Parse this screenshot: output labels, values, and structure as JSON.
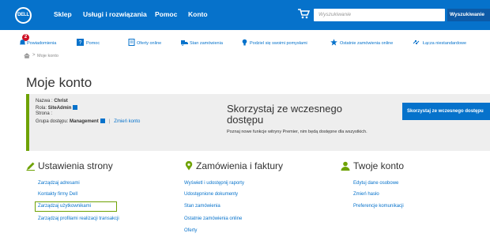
{
  "header": {
    "logo": "DELL",
    "nav": [
      "Sklep",
      "Usługi i rozwiązania",
      "Pomoc",
      "Konto"
    ],
    "search_placeholder": "Wyszukiwanie",
    "search_button": "Wyszukiwanie"
  },
  "subnav": {
    "badge": "2",
    "items": [
      "Powiadomienia",
      "Pomoc",
      "Oferty online",
      "Stan zamówienia",
      "Podziel się swoimi pomysłami",
      "Ostatnie zamówienia online",
      "Łącza niestandardowe"
    ]
  },
  "breadcrumb": {
    "current": "Moje konto"
  },
  "page_title": "Moje konto",
  "account": {
    "name_label": "Nazwa :",
    "name_value": "Christ",
    "role_label": "Rola:",
    "role_value": "SiteAdmin",
    "page_label": "Strona :",
    "group_label": "Grupa dostępu:",
    "group_value": "Management",
    "change_account": "Zmień konto"
  },
  "promo": {
    "title": "Skorzystaj ze wczesnego dostępu",
    "description": "Poznaj nowe funkcje witryny Premier, nim będą dostępne dla wszystkich.",
    "button": "Skorzystaj ze wczesnego dostępu"
  },
  "sections": {
    "settings": {
      "title": "Ustawienia strony",
      "links": [
        "Zarządzaj adresami",
        "Kontakty firmy Dell",
        "Zarządzaj użytkownikami",
        "Zarządzaj profilami realizacji transakcji"
      ]
    },
    "orders": {
      "title": "Zamówienia i faktury",
      "links": [
        "Wyświetl i udostępnij raporty",
        "Udostępnione dokumenty",
        "Stan zamówienia",
        "Ostatnie zamówienia online",
        "Oferty"
      ]
    },
    "account": {
      "title": "Twoje konto",
      "links": [
        "Edytuj dane osobowe",
        "Zmień hasło",
        "Preferencje komunikacji"
      ]
    }
  },
  "colors": {
    "brand_blue": "#0672cb",
    "accent_green": "#6ea204",
    "badge_red": "#ce1126"
  }
}
